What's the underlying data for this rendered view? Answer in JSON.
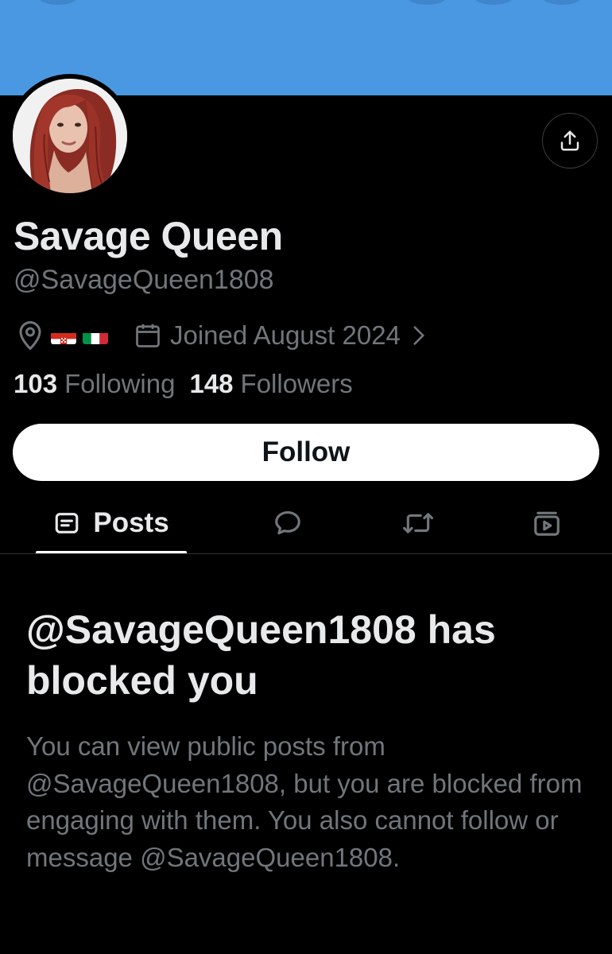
{
  "profile": {
    "display_name": "Savage Queen",
    "handle": "@SavageQueen1808",
    "location_flags": [
      "croatia-flag",
      "italy-flag"
    ],
    "joined": "Joined August 2024",
    "following_count": "103",
    "following_label": "Following",
    "followers_count": "148",
    "followers_label": "Followers"
  },
  "actions": {
    "follow_label": "Follow",
    "share_icon": "share-icon"
  },
  "tabs": [
    {
      "label": "Posts",
      "icon": "posts-icon",
      "active": true
    },
    {
      "label": "",
      "icon": "replies-icon",
      "active": false
    },
    {
      "label": "",
      "icon": "reposts-icon",
      "active": false
    },
    {
      "label": "",
      "icon": "media-icon",
      "active": false
    }
  ],
  "blocked": {
    "title": "@SavageQueen1808 has blocked you",
    "message": "You can view public posts from @SavageQueen1808, but you are blocked from engaging with them. You also cannot follow or message @SavageQueen1808."
  },
  "colors": {
    "banner": "#4a98e2",
    "background": "#000000",
    "primary_text": "#e7e9ea",
    "secondary_text": "#71767b",
    "follow_button_bg": "#ffffff"
  }
}
